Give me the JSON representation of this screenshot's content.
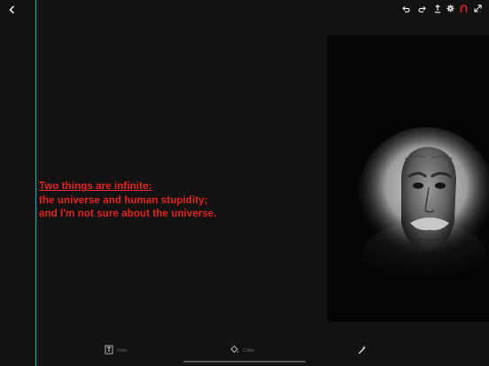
{
  "quote": {
    "lines": [
      "Two things are infinite:",
      "the universe and human stupidity;",
      "and I'm not sure about the universe."
    ]
  },
  "toolbar": {
    "font_label": "Font",
    "color_label": "Color"
  },
  "colors": {
    "background": "#121212",
    "quote_text": "#e5231f",
    "guide_line": "#17b8c4",
    "active_icon": "#e5231f"
  },
  "icons": {
    "back": "chevron-left-icon",
    "undo": "undo-icon",
    "redo": "redo-icon",
    "share": "share-icon",
    "settings": "gear-icon",
    "magnet": "magnet-icon",
    "fullscreen": "expand-icon",
    "font": "font-icon",
    "color": "paint-bucket-icon",
    "effects": "magic-wand-icon"
  }
}
